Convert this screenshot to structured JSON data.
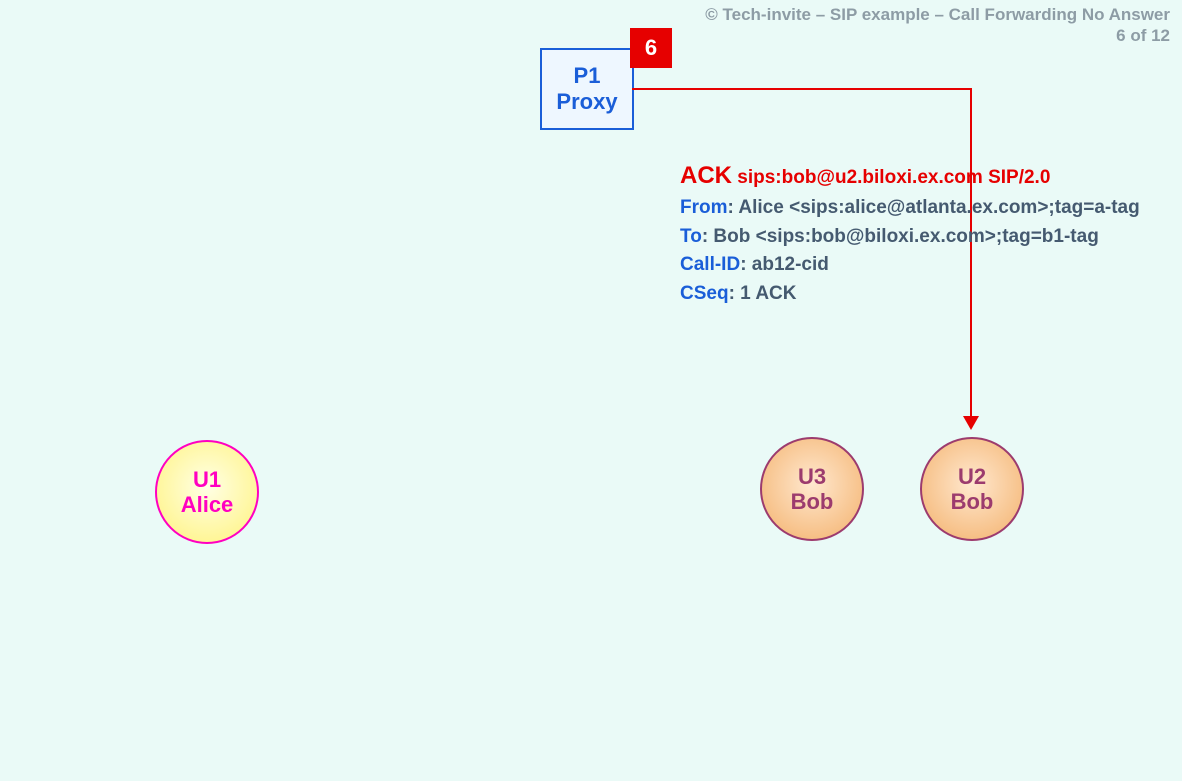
{
  "header": {
    "copyright": "© Tech-invite – SIP example – Call Forwarding No Answer",
    "page_indicator": "6 of 12"
  },
  "step_number": "6",
  "proxy": {
    "line1": "P1",
    "line2": "Proxy"
  },
  "message": {
    "method": "ACK",
    "request_uri": "sips:bob@u2.biloxi.ex.com SIP/2.0",
    "from_label": "From",
    "from_value": ": Alice <sips:alice@atlanta.ex.com>;tag=a-tag",
    "to_label": "To",
    "to_value": ": Bob <sips:bob@biloxi.ex.com>;tag=b1-tag",
    "callid_label": "Call-ID",
    "callid_value": ": ab12-cid",
    "cseq_label": "CSeq",
    "cseq_value": ": 1 ACK"
  },
  "endpoints": {
    "u1": {
      "id": "U1",
      "name": "Alice"
    },
    "u3": {
      "id": "U3",
      "name": "Bob"
    },
    "u2": {
      "id": "U2",
      "name": "Bob"
    }
  }
}
